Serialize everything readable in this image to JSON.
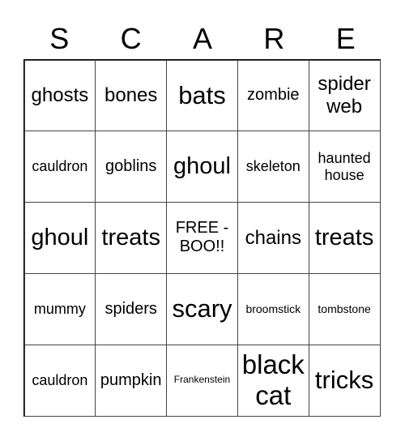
{
  "header": [
    "S",
    "C",
    "A",
    "R",
    "E"
  ],
  "cells": [
    "ghosts",
    "bones",
    "bats",
    "zombie",
    "spider web",
    "cauldron",
    "goblins",
    "ghoul",
    "skeleton",
    "haunted house",
    "ghoul",
    "treats",
    "FREE - BOO!!",
    "chains",
    "treats",
    "mummy",
    "spiders",
    "scary",
    "broomstick",
    "tombstone",
    "cauldron",
    "pumpkin",
    "Frankenstein",
    "black cat",
    "tricks"
  ]
}
